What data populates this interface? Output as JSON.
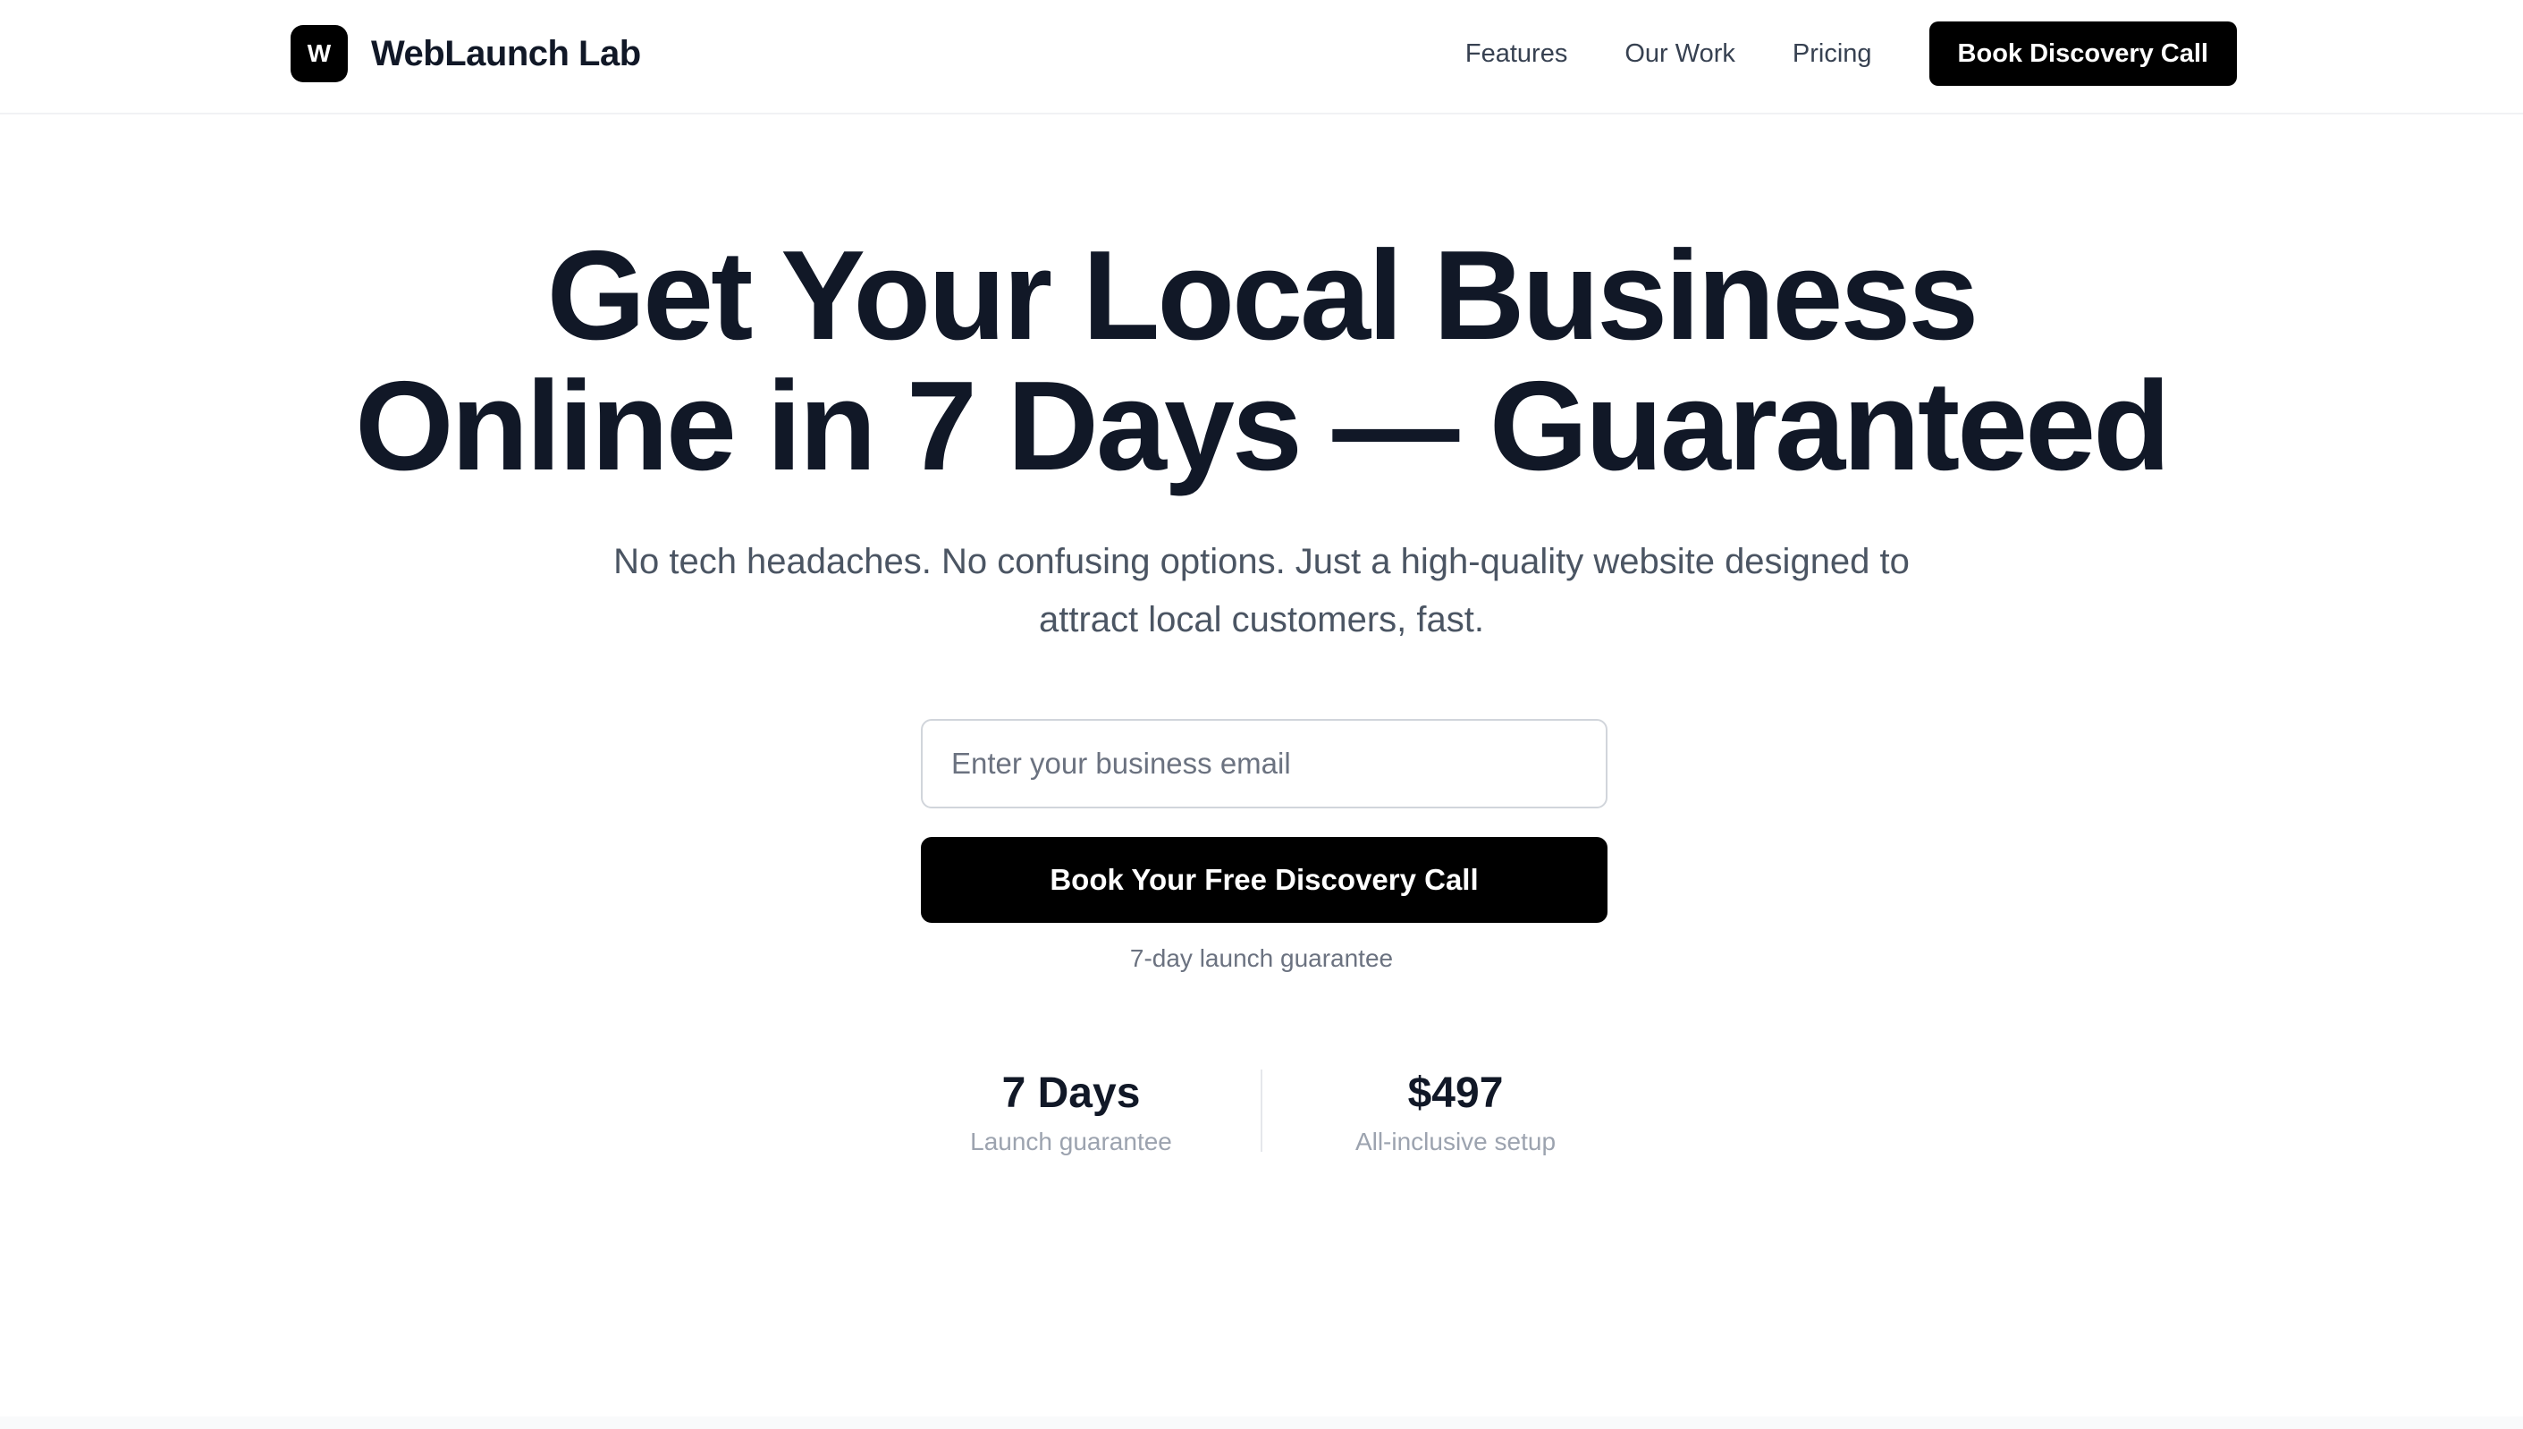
{
  "brand": {
    "logo_letter": "W",
    "name": "WebLaunch Lab"
  },
  "nav": {
    "links": [
      "Features",
      "Our Work",
      "Pricing"
    ],
    "cta_label": "Book Discovery Call"
  },
  "hero": {
    "title_line1": "Get Your Local Business",
    "title_line2": "Online in 7 Days — Guaranteed",
    "subtitle_line1": "No tech headaches. No confusing options. Just a high-quality website designed to",
    "subtitle_line2": "attract local customers, fast.",
    "email_placeholder": "Enter your business email",
    "cta_label": "Book Your Free Discovery Call",
    "note": "7-day launch guarantee"
  },
  "stats": [
    {
      "value": "7 Days",
      "label": "Launch guarantee"
    },
    {
      "value": "$497",
      "label": "All-inclusive setup"
    }
  ],
  "colors": {
    "primary": "#000000",
    "heading": "#111827",
    "body_text": "#4b5563",
    "muted": "#9ca3af"
  },
  "icons": {
    "logo": "letter-w-logo-icon"
  }
}
